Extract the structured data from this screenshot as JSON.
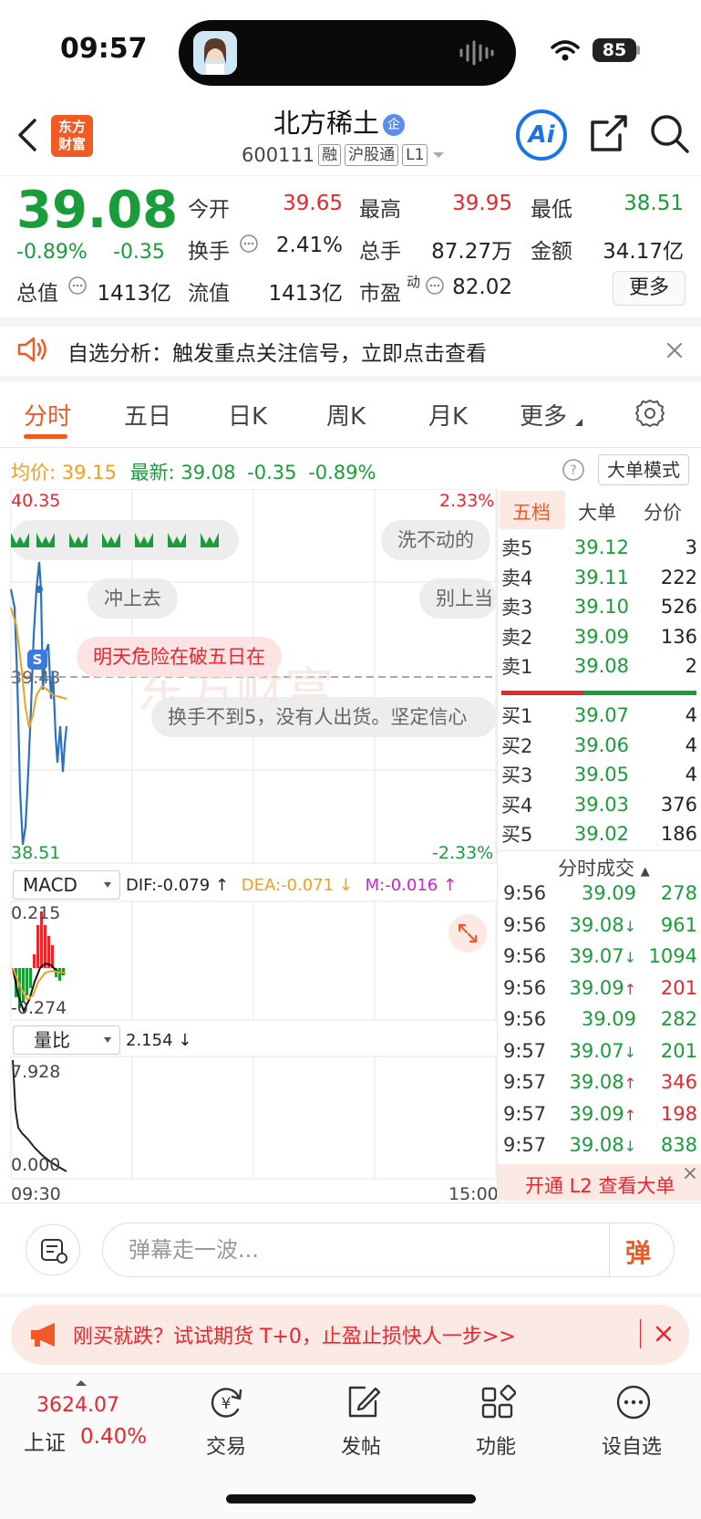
{
  "status_bar": {
    "time": "09:57",
    "battery": "85"
  },
  "header": {
    "logo_text": "东方财富",
    "stock_name": "北方稀土",
    "stock_badge": "企",
    "stock_code": "600111",
    "tags": [
      "融",
      "沪股通",
      "L1"
    ],
    "ai_label": "Ai"
  },
  "quote": {
    "price": "39.08",
    "change_pct": "-0.89%",
    "change": "-0.35",
    "labels": {
      "open": "今开",
      "high": "最高",
      "low": "最低",
      "turnover": "换手",
      "volume": "总手",
      "amount": "金额",
      "mktcap": "总值",
      "float_cap": "流值",
      "pe": "市盈",
      "pe_sup": "动"
    },
    "open": "39.65",
    "high": "39.95",
    "low": "38.51",
    "turnover": "2.41%",
    "volume": "87.27万",
    "amount": "34.17亿",
    "mktcap": "1413亿",
    "float_cap": "1413亿",
    "pe": "82.02",
    "more": "更多"
  },
  "notice": {
    "text": "自选分析：触发重点关注信号，立即点击查看"
  },
  "tabs": [
    {
      "label": "分时",
      "active": true
    },
    {
      "label": "五日"
    },
    {
      "label": "日K"
    },
    {
      "label": "周K"
    },
    {
      "label": "月K"
    },
    {
      "label": "更多"
    }
  ],
  "chart_header": {
    "avg_label": "均价:",
    "avg": "39.15",
    "last_label": "最新:",
    "last": "39.08",
    "chg": "-0.35",
    "pct": "-0.89%",
    "mode_button": "大单模式"
  },
  "chart_labels": {
    "top_price": "40.35",
    "top_pct": "2.33%",
    "ref_price": "39.43",
    "bottom_price": "38.51",
    "bottom_pct": "-2.33%",
    "s_marker": "S",
    "time_start": "09:30",
    "time_end": "15:00"
  },
  "danmu": [
    "洗不动的",
    "冲上去",
    "别上当",
    "明天危险在破五日在",
    "换手不到5，没有人出货。坚定信心"
  ],
  "macd": {
    "selector": "MACD",
    "dif": "DIF:-0.079 ↑",
    "dea": "DEA:-0.071 ↓",
    "m": "M:-0.016 ↑",
    "top": "0.215",
    "bottom": "-0.274"
  },
  "volume_ratio": {
    "selector": "量比",
    "value": "2.154 ↓",
    "top": "7.928",
    "bottom": "0.000"
  },
  "panel_tabs": [
    "五档",
    "大单",
    "分价"
  ],
  "order_book": {
    "asks": [
      {
        "label": "卖5",
        "price": "39.12",
        "vol": "3"
      },
      {
        "label": "卖4",
        "price": "39.11",
        "vol": "222"
      },
      {
        "label": "卖3",
        "price": "39.10",
        "vol": "526"
      },
      {
        "label": "卖2",
        "price": "39.09",
        "vol": "136"
      },
      {
        "label": "卖1",
        "price": "39.08",
        "vol": "2"
      }
    ],
    "bids": [
      {
        "label": "买1",
        "price": "39.07",
        "vol": "4"
      },
      {
        "label": "买2",
        "price": "39.06",
        "vol": "4"
      },
      {
        "label": "买3",
        "price": "39.05",
        "vol": "4"
      },
      {
        "label": "买4",
        "price": "39.03",
        "vol": "376"
      },
      {
        "label": "买5",
        "price": "39.02",
        "vol": "186"
      }
    ]
  },
  "trades_title": "分时成交",
  "trades": [
    {
      "time": "9:56",
      "price": "39.09",
      "arrow": "",
      "vol": "278",
      "vcolor": "green"
    },
    {
      "time": "9:56",
      "price": "39.08",
      "arrow": "↓",
      "vol": "961",
      "vcolor": "green"
    },
    {
      "time": "9:56",
      "price": "39.07",
      "arrow": "↓",
      "vol": "1094",
      "vcolor": "green"
    },
    {
      "time": "9:56",
      "price": "39.09",
      "arrow": "↑",
      "vol": "201",
      "vcolor": "red"
    },
    {
      "time": "9:56",
      "price": "39.09",
      "arrow": "",
      "vol": "282",
      "vcolor": "green"
    },
    {
      "time": "9:57",
      "price": "39.07",
      "arrow": "↓",
      "vol": "201",
      "vcolor": "green"
    },
    {
      "time": "9:57",
      "price": "39.08",
      "arrow": "↑",
      "vol": "346",
      "vcolor": "red"
    },
    {
      "time": "9:57",
      "price": "39.09",
      "arrow": "↑",
      "vol": "198",
      "vcolor": "red"
    },
    {
      "time": "9:57",
      "price": "39.08",
      "arrow": "↓",
      "vol": "838",
      "vcolor": "green"
    }
  ],
  "l2_banner": "开通 L2 查看大单",
  "danmu_input": {
    "placeholder": "弹幕走一波...",
    "send_label": "弹"
  },
  "promo": {
    "text": "刚买就跌？试试期货 T+0，止盈止损快人一步>>"
  },
  "bottom_nav": {
    "index_value": "3624.07",
    "index_name": "上证",
    "index_pct": "0.40%",
    "items": [
      "交易",
      "发帖",
      "功能",
      "设自选"
    ]
  },
  "colors": {
    "accent": "#f15a24",
    "up": "#e8262e",
    "down": "#1a9c3a",
    "avg_line": "#f0a020",
    "price_line": "#2a72c0"
  }
}
